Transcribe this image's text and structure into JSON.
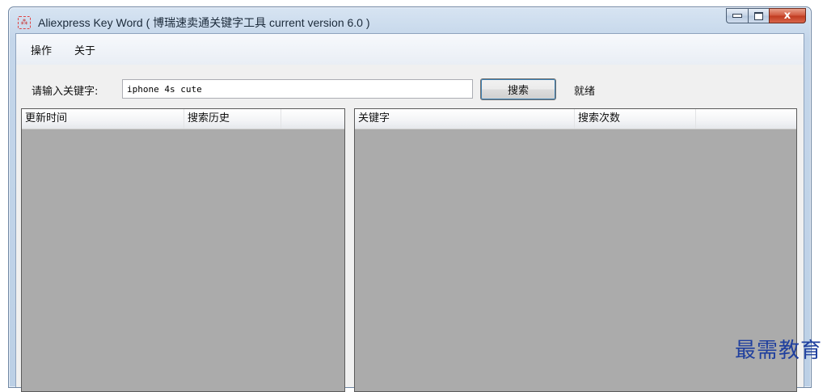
{
  "window": {
    "title": "Aliexpress Key Word ( 博瑞速卖通关键字工具 current version 6.0 )",
    "app_icon": "app-logo-icon",
    "close_glyph": "x"
  },
  "menu": {
    "items": [
      {
        "label": "操作"
      },
      {
        "label": "关于"
      }
    ]
  },
  "search": {
    "label": "请输入关键字:",
    "value": "iphone 4s cute",
    "button_label": "搜索",
    "status": "就绪"
  },
  "history_table": {
    "columns": [
      "更新时间",
      "搜索历史"
    ],
    "rows": []
  },
  "keyword_table": {
    "columns": [
      "关键字",
      "搜索次数"
    ],
    "rows": []
  },
  "watermark": "最需教育",
  "colors": {
    "panel_bg": "#ababab",
    "close_button": "#c8442a",
    "watermark": "#1f3f9e"
  }
}
